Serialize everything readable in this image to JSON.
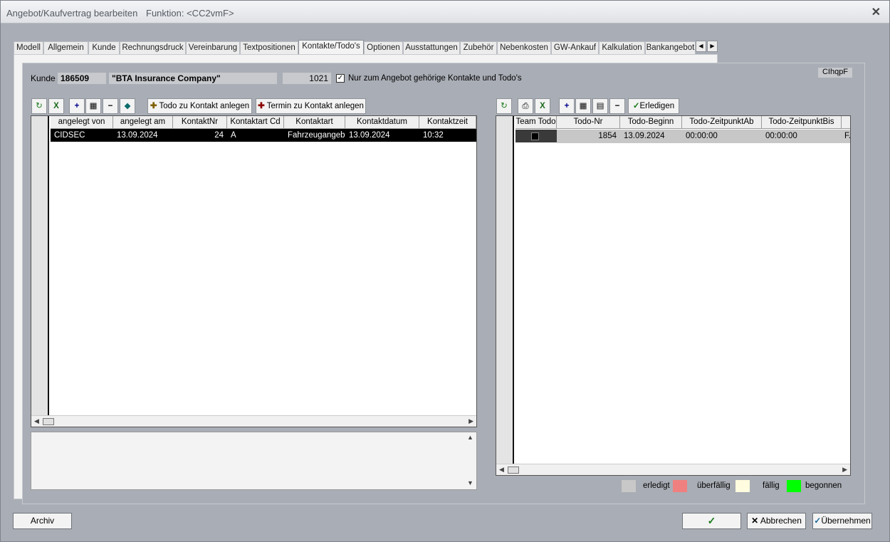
{
  "window": {
    "title": "Angebot/Kaufvertrag bearbeiten",
    "function": "Funktion: <CC2vmF>"
  },
  "tabs": [
    "Modell",
    "Allgemein",
    "Kunde",
    "Rechnungsdruck",
    "Vereinbarung",
    "Textpositionen",
    "Kontakte/Todo's",
    "Optionen",
    "Ausstattungen",
    "Zubehör",
    "Nebenkosten",
    "GW-Ankauf",
    "Kalkulation",
    "Bankangebot"
  ],
  "active_tab": "Kontakte/Todo's",
  "header": {
    "kunde_label": "Kunde",
    "kunde_nr": "186509",
    "kunde_name": "\"BTA  Insurance Company\"",
    "angebot_nr": "1021",
    "checkbox_checked": true,
    "checkbox_label": "Nur zum Angebot gehörige Kontakte und Todo's",
    "code": "CIhqpF"
  },
  "left_toolbar": {
    "todo_button": "Todo zu Kontakt anlegen",
    "termin_button": "Termin zu Kontakt anlegen"
  },
  "contacts_grid": {
    "columns": [
      "angelegt von",
      "angelegt am",
      "KontaktNr",
      "Kontaktart Cd",
      "Kontaktart",
      "Kontaktdatum",
      "Kontaktzeit"
    ],
    "rows": [
      [
        "CIDSEC",
        "13.09.2024",
        "24",
        "A",
        "Fahrzeugangeb",
        "13.09.2024",
        "10:32"
      ]
    ]
  },
  "right_toolbar": {
    "erledigen_button": "Erledigen"
  },
  "todo_grid": {
    "columns": [
      "Team Todo",
      "Todo-Nr",
      "Todo-Beginn",
      "Todo-ZeitpunktAb",
      "Todo-ZeitpunktBis"
    ],
    "rows": [
      [
        "",
        "1854",
        "13.09.2024",
        "00:00:00",
        "00:00:00",
        "F."
      ]
    ]
  },
  "legend": [
    {
      "label": "erledigt",
      "color": "#c8c8c8"
    },
    {
      "label": "überfällig",
      "color": "#f08080"
    },
    {
      "label": "fällig",
      "color": "#fffce0"
    },
    {
      "label": "begonnen",
      "color": "#00ff00"
    }
  ],
  "buttons": {
    "archiv": "Archiv",
    "abbrechen": "Abbrechen",
    "uebernehmen": "Übernehmen"
  }
}
